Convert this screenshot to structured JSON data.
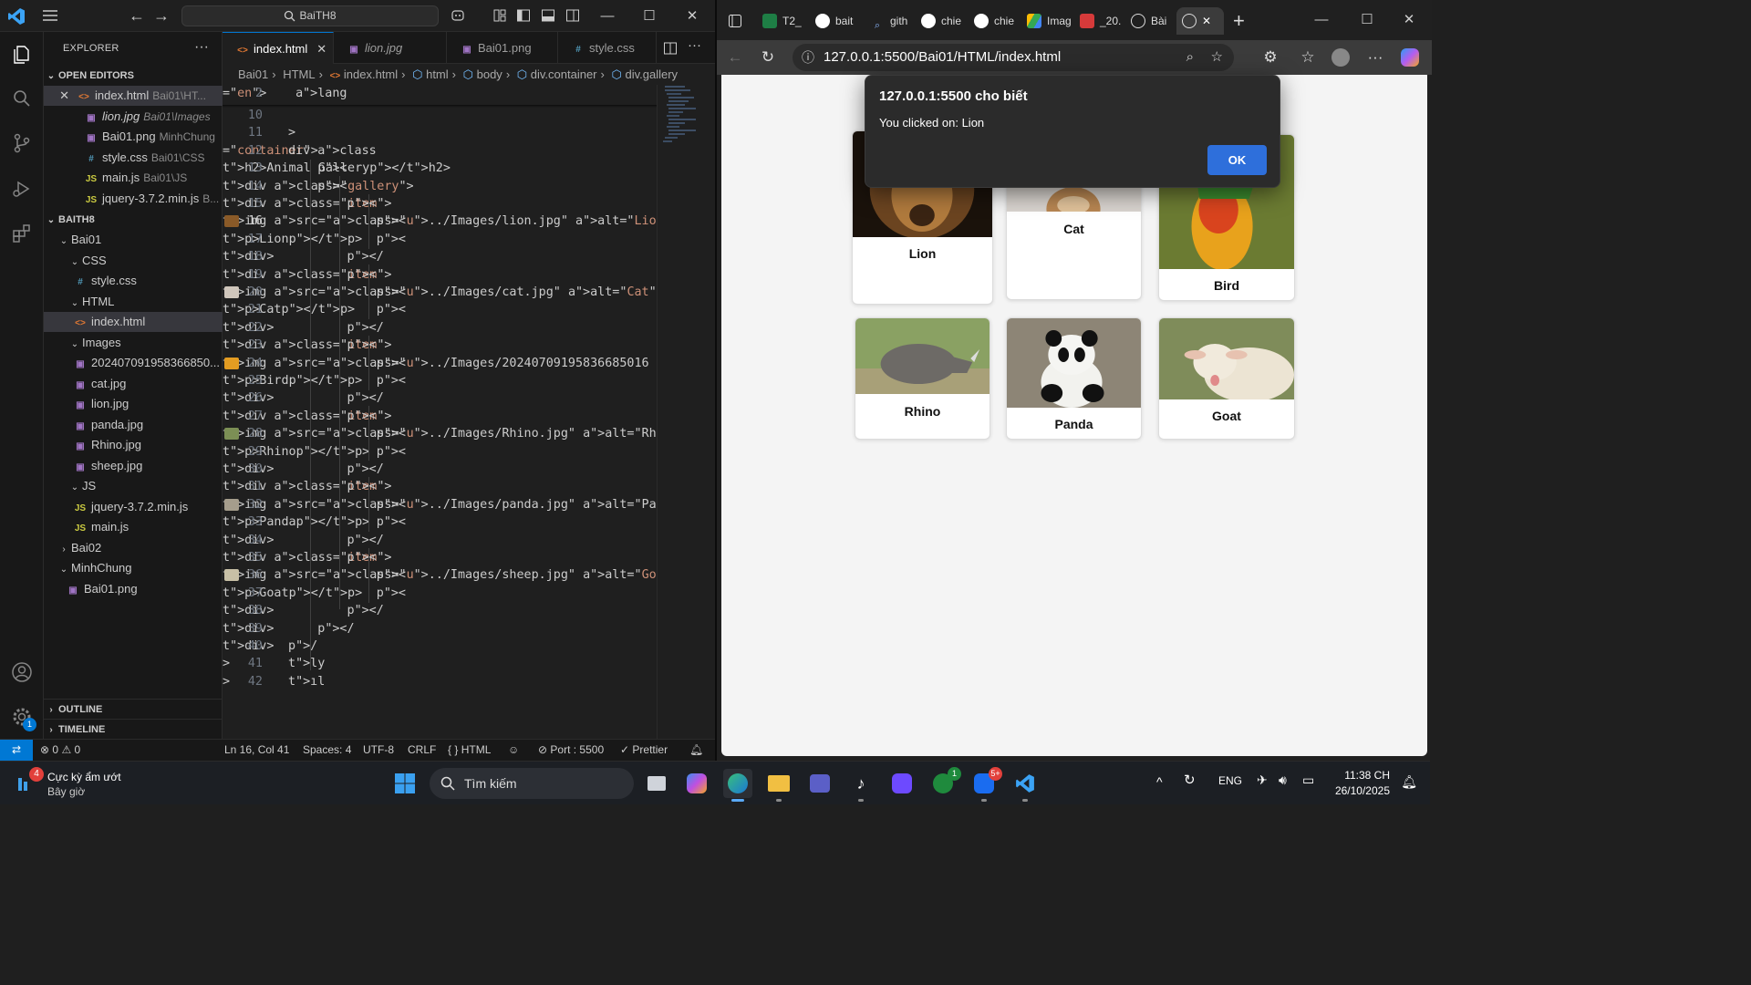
{
  "vscode": {
    "search": "BaiTH8",
    "explorer_title": "EXPLORER",
    "open_editors_label": "OPEN EDITORS",
    "open_editors": [
      {
        "name": "index.html",
        "desc": "Bai01\\HT..."
      },
      {
        "name": "lion.jpg",
        "desc": "Bai01\\Images"
      },
      {
        "name": "Bai01.png",
        "desc": "MinhChung"
      },
      {
        "name": "style.css",
        "desc": "Bai01\\CSS"
      },
      {
        "name": "main.js",
        "desc": "Bai01\\JS"
      },
      {
        "name": "jquery-3.7.2.min.js",
        "desc": "B..."
      }
    ],
    "workspace_label": "BAITH8",
    "tree": {
      "bai01": "Bai01",
      "css": "CSS",
      "style": "style.css",
      "html": "HTML",
      "index": "index.html",
      "images": "Images",
      "img1": "202407091958366850...",
      "cat": "cat.jpg",
      "lion": "lion.jpg",
      "panda": "panda.jpg",
      "rhino": "Rhino.jpg",
      "sheep": "sheep.jpg",
      "js": "JS",
      "jquery": "jquery-3.7.2.min.js",
      "main": "main.js",
      "bai02": "Bai02",
      "minhchung": "MinhChung",
      "bai01png": "Bai01.png"
    },
    "outline_label": "OUTLINE",
    "timeline_label": "TIMELINE",
    "tabs": [
      "index.html",
      "lion.jpg",
      "Bai01.png",
      "style.css"
    ],
    "breadcrumb": [
      "Bai01",
      "HTML",
      "index.html",
      "html",
      "body",
      "div.container",
      "div.gallery"
    ],
    "sticky_line": {
      "num": "2",
      "text": " lang=\"en\">"
    },
    "code_lines": [
      {
        "num": "10",
        "text": ""
      },
      {
        "num": "11",
        "text": ">"
      },
      {
        "num": "12",
        "text": "div class=\"container\">"
      },
      {
        "num": "13",
        "text": "    <h2>Animal Gallery</h2>"
      },
      {
        "num": "14",
        "text": "    <div class=\"gallery\">"
      },
      {
        "num": "15",
        "text": "        <div class=\"item\">"
      },
      {
        "num": "16",
        "text": "            <img src=\"../Images/lion.jpg\" alt=\"Lion\""
      },
      {
        "num": "17",
        "text": "            <p>Lion</p>"
      },
      {
        "num": "18",
        "text": "        </div>"
      },
      {
        "num": "19",
        "text": "        <div class=\"item\">"
      },
      {
        "num": "20",
        "text": "            <img src=\"../Images/cat.jpg\" alt=\"Cat\">"
      },
      {
        "num": "21",
        "text": "            <p>Cat</p>"
      },
      {
        "num": "22",
        "text": "        </div>"
      },
      {
        "num": "23",
        "text": "        <div class=\"item\">"
      },
      {
        "num": "24",
        "text": "            <img src=\"../Images/20240709195836685016"
      },
      {
        "num": "25",
        "text": "            <p>Bird</p>"
      },
      {
        "num": "26",
        "text": "        </div>"
      },
      {
        "num": "27",
        "text": "        <div class=\"item\">"
      },
      {
        "num": "28",
        "text": "            <img src=\"../Images/Rhino.jpg\" alt=\"Rhin"
      },
      {
        "num": "29",
        "text": "            <p>Rhino</p>"
      },
      {
        "num": "30",
        "text": "        </div>"
      },
      {
        "num": "31",
        "text": "        <div class=\"item\">"
      },
      {
        "num": "32",
        "text": "            <img src=\"../Images/panda.jpg\" alt=\"Panda"
      },
      {
        "num": "33",
        "text": "            <p>Panda</p>"
      },
      {
        "num": "34",
        "text": "        </div>"
      },
      {
        "num": "35",
        "text": "        <div class=\"item\">"
      },
      {
        "num": "36",
        "text": "            <img src=\"../Images/sheep.jpg\" alt=\"Goat\""
      },
      {
        "num": "37",
        "text": "            <p>Goat</p>"
      },
      {
        "num": "38",
        "text": "        </div>"
      },
      {
        "num": "39",
        "text": "    </div>"
      },
      {
        "num": "40",
        "text": "/div>"
      },
      {
        "num": "41",
        "text": "ly>"
      },
      {
        "num": "42",
        "text": "ıl>"
      }
    ],
    "status": {
      "errors": "0",
      "warnings": "0",
      "position": "Ln 16, Col 41",
      "spaces": "Spaces: 4",
      "encoding": "UTF-8",
      "eol": "CRLF",
      "language": "HTML",
      "port": "Port : 5500",
      "prettier": "Prettier"
    },
    "accounts_badge": "1"
  },
  "browser": {
    "tabs": [
      "T2_",
      "bait",
      "gith",
      "chie",
      "chie",
      "Imag",
      "_20.",
      "Bài"
    ],
    "url": "127.0.0.1:5500/Bai01/HTML/index.html",
    "gallery": [
      {
        "caption": "Lion"
      },
      {
        "caption": "Cat"
      },
      {
        "caption": "Bird"
      },
      {
        "caption": "Rhino"
      },
      {
        "caption": "Panda"
      },
      {
        "caption": "Goat"
      }
    ],
    "alert": {
      "title": "127.0.0.1:5500 cho biết",
      "message": "You clicked on: Lion",
      "ok": "OK"
    }
  },
  "taskbar": {
    "weather_badge": "4",
    "weather_title": "Cực kỳ ẩm ướt",
    "weather_sub": "Bây giờ",
    "search": "Tìm kiếm",
    "xbox_badge": "1",
    "zalo_badge": "5+",
    "lang": "ENG",
    "time": "11:38 CH",
    "date": "26/10/2025"
  },
  "colors": {
    "accent": "#0078d4",
    "alert_ok": "#2e6fdb"
  }
}
